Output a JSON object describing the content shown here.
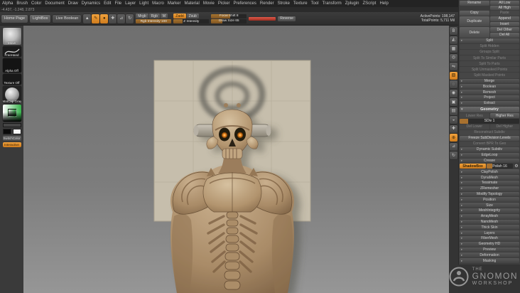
{
  "menu_bar": {
    "items": [
      "Alpha",
      "Brush",
      "Color",
      "Document",
      "Draw",
      "Dynamics",
      "Edit",
      "File",
      "Layer",
      "Light",
      "Macro",
      "Marker",
      "Material",
      "Movie",
      "Picker",
      "Preferences",
      "Render",
      "Stroke",
      "Texture",
      "Tool",
      "Transform",
      "Zplugin",
      "ZScript",
      "Help"
    ]
  },
  "coords_readout": "-4.437, -1.248, 2.873",
  "top_shelf": {
    "home_page": "Home Page",
    "lightbox": "LightBox",
    "live_boolean": "Live Boolean",
    "tool_icons": [
      {
        "name": "sculptris-pro-icon",
        "glyph": "▲",
        "active": false
      },
      {
        "name": "edit-object-icon",
        "glyph": "✎",
        "active": true
      },
      {
        "name": "draw-pointer-icon",
        "glyph": "●",
        "active": true
      },
      {
        "name": "move-icon",
        "glyph": "✚",
        "active": false
      },
      {
        "name": "scale-icon",
        "glyph": "⊿",
        "active": false
      },
      {
        "name": "rotate-icon",
        "glyph": "↻",
        "active": false
      }
    ],
    "mrgb": "Mrgb",
    "rgb": "Rgb",
    "m": "M",
    "rgb_intensity": "Rgb Intensity 100",
    "zadd": "Zadd",
    "zsub": "Zsub",
    "z_intensity": "Z Intensity",
    "focal_shift": "Focal Shift 8",
    "draw_size": "Draw Size 65",
    "reverse": "Reverse",
    "active_points": "ActivePoints: 198,147",
    "total_points": "TotalPoints: 5,711 Mil"
  },
  "left_shelf": {
    "brush_label": "Move",
    "stroke_label": "FreeHand",
    "alpha_label": "Alpha Off",
    "texture_label": "Texture Off",
    "material_label": "MatCap Gray",
    "switch_color": "SwitchColor",
    "interactive": "Interactive"
  },
  "right_shelf": {
    "icons": [
      {
        "name": "bpr-render-icon",
        "glyph": "B",
        "active": false
      },
      {
        "name": "persp-icon",
        "glyph": "◭",
        "active": false
      },
      {
        "name": "floor-grid-icon",
        "glyph": "▦",
        "active": false
      },
      {
        "name": "local-symmetry-icon",
        "glyph": "◎",
        "active": false
      },
      {
        "name": "lsym-icon",
        "glyph": "⇋",
        "active": false
      },
      {
        "name": "transp-icon",
        "glyph": "▧",
        "active": true
      },
      {
        "name": "ghost-icon",
        "glyph": "◌",
        "active": false
      },
      {
        "name": "solo-icon",
        "glyph": "◉",
        "active": false
      },
      {
        "name": "frame-icon",
        "glyph": "▣",
        "active": false
      },
      {
        "name": "polyframe-icon",
        "glyph": "▤",
        "active": false
      },
      {
        "name": "silhouette-icon",
        "glyph": "◒",
        "active": false
      },
      {
        "name": "scroll-canvas-icon",
        "glyph": "✚",
        "active": false
      },
      {
        "name": "zoom-canvas-icon",
        "glyph": "⊕",
        "active": true
      },
      {
        "name": "scale-canvas-icon",
        "glyph": "⊿",
        "active": false
      },
      {
        "name": "rotate-canvas-icon",
        "glyph": "↻",
        "active": false
      }
    ]
  },
  "right_panel": {
    "subtool": {
      "rename": "Rename",
      "all_low": "All Low",
      "all_high": "All High",
      "copy": "Copy",
      "paste": "Paste",
      "duplicate": "Duplicate",
      "append": "Append",
      "insert": "Insert",
      "delete": "Delete",
      "del_other": "Del Other",
      "del_all": "Del All",
      "split_header": "Split",
      "split_items": [
        {
          "label": "Split Hidden",
          "disabled": true
        },
        {
          "label": "Groups Split",
          "disabled": true
        },
        {
          "label": "Split To Similar Parts",
          "disabled": true
        },
        {
          "label": "Split To Parts",
          "disabled": true
        },
        {
          "label": "Split Unmasked Points",
          "disabled": true
        },
        {
          "label": "Split Masked Points",
          "disabled": true
        }
      ],
      "section_headers": [
        "Merge",
        "Boolean",
        "Remesh",
        "Project",
        "Extract"
      ]
    },
    "geometry": {
      "header": "Geometry",
      "lower_res": "Lower Res",
      "higher_res": "Higher Res",
      "sdiv": "SDiv 1",
      "del_lower": "Del Lower",
      "del_higher": "Del Higher",
      "reconstruct": "Reconstruct Subdiv",
      "freeze": "Freeze SubDivision Levels",
      "convert_bpr": "Convert BPR To Geo",
      "sub_headers_a": [
        "Dynamic Subdiv",
        "EdgeLoop",
        "Crease"
      ],
      "shadowbox": "ShadowBox",
      "polish": "Polish 16",
      "gear_glyph": "⚙",
      "sub_headers_b": [
        "ClayPolish",
        "DynaMesh",
        "Tessimate",
        "ZRemesher",
        "Modify Topology",
        "Position",
        "Size",
        "MeshIntegrity"
      ]
    },
    "tool_sections": [
      "ArrayMesh",
      "NanoMesh",
      "Thick Skin",
      "Layers",
      "FiberMesh",
      "Geometry HD",
      "Preview",
      "Deformation",
      "Masking"
    ]
  },
  "watermark": {
    "the": "THE",
    "gnomon": "GNOMON",
    "workshop": "WORKSHOP"
  }
}
